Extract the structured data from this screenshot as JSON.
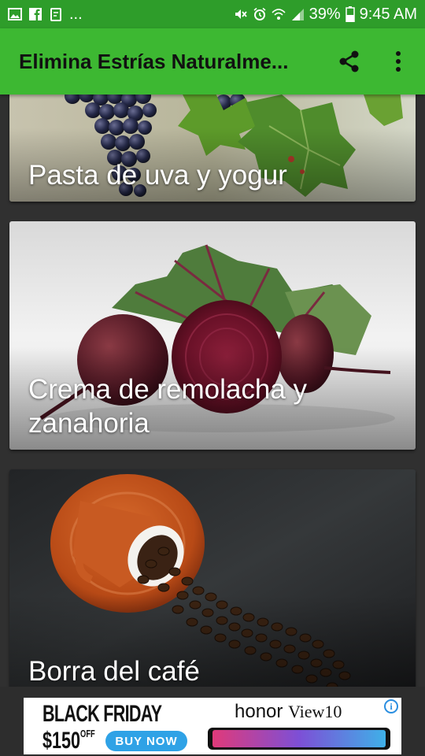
{
  "status_bar": {
    "notif_more": "...",
    "battery": "39%",
    "time": "9:45 AM"
  },
  "app_bar": {
    "title": "Elimina Estrías Naturalme...",
    "share_icon": "share-icon",
    "more_icon": "more-vert-icon"
  },
  "cards": [
    {
      "title": "Pasta de uva y yogur"
    },
    {
      "title": "Crema de remolacha y zanahoria"
    },
    {
      "title": "Borra del café"
    }
  ],
  "ad": {
    "headline": "BLACK FRIDAY",
    "price": "$150",
    "price_suffix": "OFF",
    "cta": "BUY NOW",
    "brand": "honor",
    "model": "View10",
    "info_icon": "info-icon"
  },
  "colors": {
    "status_bar": "#2e9d2a",
    "app_bar": "#3db832",
    "background": "#303030",
    "cta": "#2fa2e6"
  }
}
